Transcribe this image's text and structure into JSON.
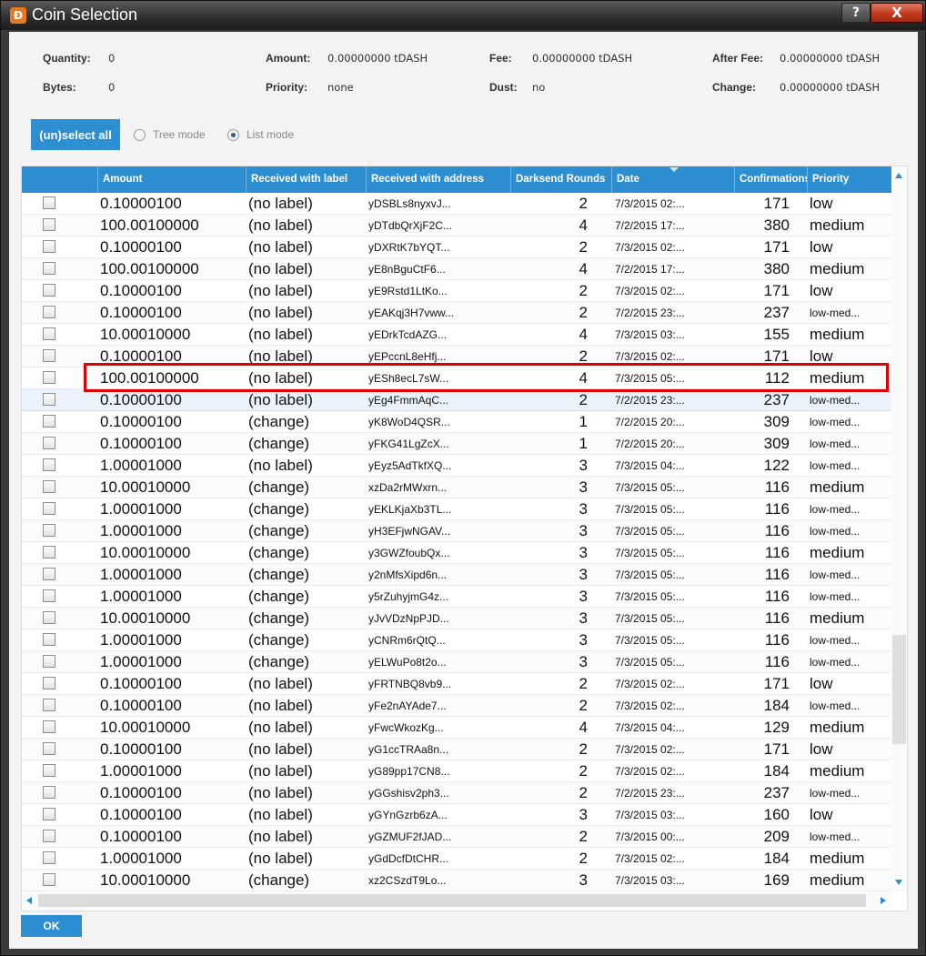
{
  "window": {
    "title": "Coin Selection",
    "help_label": "?",
    "close_label": "X"
  },
  "summary": {
    "quantity_label": "Quantity:",
    "quantity": "0",
    "bytes_label": "Bytes:",
    "bytes": "0",
    "amount_label": "Amount:",
    "amount": "0.00000000 tDASH",
    "priority_label": "Priority:",
    "priority": "none",
    "fee_label": "Fee:",
    "fee": "0.00000000 tDASH",
    "dust_label": "Dust:",
    "dust": "no",
    "after_fee_label": "After Fee:",
    "after_fee": "0.00000000 tDASH",
    "change_label": "Change:",
    "change": "0.00000000 tDASH"
  },
  "controls": {
    "select_all_label": "(un)select all",
    "tree_mode_label": "Tree mode",
    "list_mode_label": "List mode",
    "selected_mode": "list"
  },
  "table": {
    "columns": [
      "",
      "Amount",
      "Received with label",
      "Received with address",
      "Darksend Rounds",
      "Date",
      "Confirmations",
      "Priority"
    ],
    "rows": [
      {
        "amount": "0.10000100",
        "label": "(no label)",
        "address": "yDSBLs8nyxvJ...",
        "rounds": "2",
        "date": "7/3/2015 02:...",
        "conf": "171",
        "priority": "low"
      },
      {
        "amount": "100.00100000",
        "label": "(no label)",
        "address": "yDTdbQrXjF2C...",
        "rounds": "4",
        "date": "7/2/2015 17:...",
        "conf": "380",
        "priority": "medium"
      },
      {
        "amount": "0.10000100",
        "label": "(no label)",
        "address": "yDXRtK7bYQT...",
        "rounds": "2",
        "date": "7/3/2015 02:...",
        "conf": "171",
        "priority": "low"
      },
      {
        "amount": "100.00100000",
        "label": "(no label)",
        "address": "yE8nBguCtF6...",
        "rounds": "4",
        "date": "7/2/2015 17:...",
        "conf": "380",
        "priority": "medium"
      },
      {
        "amount": "0.10000100",
        "label": "(no label)",
        "address": "yE9Rstd1LtKo...",
        "rounds": "2",
        "date": "7/3/2015 02:...",
        "conf": "171",
        "priority": "low"
      },
      {
        "amount": "0.10000100",
        "label": "(no label)",
        "address": "yEAKqj3H7vww...",
        "rounds": "2",
        "date": "7/2/2015 23:...",
        "conf": "237",
        "priority": "low-med..."
      },
      {
        "amount": "10.00010000",
        "label": "(no label)",
        "address": "yEDrkTcdAZG...",
        "rounds": "4",
        "date": "7/3/2015 03:...",
        "conf": "155",
        "priority": "medium"
      },
      {
        "amount": "0.10000100",
        "label": "(no label)",
        "address": "yEPccnL8eHfj...",
        "rounds": "2",
        "date": "7/3/2015 02:...",
        "conf": "171",
        "priority": "low"
      },
      {
        "amount": "100.00100000",
        "label": "(no label)",
        "address": "yESh8ecL7sW...",
        "rounds": "4",
        "date": "7/3/2015 05:...",
        "conf": "112",
        "priority": "medium"
      },
      {
        "amount": "0.10000100",
        "label": "(no label)",
        "address": "yEg4FmmAqC...",
        "rounds": "2",
        "date": "7/2/2015 23:...",
        "conf": "237",
        "priority": "low-med..."
      },
      {
        "amount": "0.10000100",
        "label": "(change)",
        "address": "yK8WoD4QSR...",
        "rounds": "1",
        "date": "7/2/2015 20:...",
        "conf": "309",
        "priority": "low-med..."
      },
      {
        "amount": "0.10000100",
        "label": "(change)",
        "address": "yFKG41LgZcX...",
        "rounds": "1",
        "date": "7/2/2015 20:...",
        "conf": "309",
        "priority": "low-med..."
      },
      {
        "amount": "1.00001000",
        "label": "(no label)",
        "address": "yEyz5AdTkfXQ...",
        "rounds": "3",
        "date": "7/3/2015 04:...",
        "conf": "122",
        "priority": "low-med..."
      },
      {
        "amount": "10.00010000",
        "label": "(change)",
        "address": "xzDa2rMWxrn...",
        "rounds": "3",
        "date": "7/3/2015 05:...",
        "conf": "116",
        "priority": "medium"
      },
      {
        "amount": "1.00001000",
        "label": "(change)",
        "address": "yEKLKjaXb3TL...",
        "rounds": "3",
        "date": "7/3/2015 05:...",
        "conf": "116",
        "priority": "low-med..."
      },
      {
        "amount": "1.00001000",
        "label": "(change)",
        "address": "yH3EFjwNGAV...",
        "rounds": "3",
        "date": "7/3/2015 05:...",
        "conf": "116",
        "priority": "low-med..."
      },
      {
        "amount": "10.00010000",
        "label": "(change)",
        "address": "y3GWZfoubQx...",
        "rounds": "3",
        "date": "7/3/2015 05:...",
        "conf": "116",
        "priority": "medium"
      },
      {
        "amount": "1.00001000",
        "label": "(change)",
        "address": "y2nMfsXipd6n...",
        "rounds": "3",
        "date": "7/3/2015 05:...",
        "conf": "116",
        "priority": "low-med..."
      },
      {
        "amount": "1.00001000",
        "label": "(change)",
        "address": "y5rZuhyjmG4z...",
        "rounds": "3",
        "date": "7/3/2015 05:...",
        "conf": "116",
        "priority": "low-med..."
      },
      {
        "amount": "10.00010000",
        "label": "(change)",
        "address": "yJvVDzNpPJD...",
        "rounds": "3",
        "date": "7/3/2015 05:...",
        "conf": "116",
        "priority": "medium"
      },
      {
        "amount": "1.00001000",
        "label": "(change)",
        "address": "yCNRm6rQtQ...",
        "rounds": "3",
        "date": "7/3/2015 05:...",
        "conf": "116",
        "priority": "low-med..."
      },
      {
        "amount": "1.00001000",
        "label": "(change)",
        "address": "yELWuPo8t2o...",
        "rounds": "3",
        "date": "7/3/2015 05:...",
        "conf": "116",
        "priority": "low-med..."
      },
      {
        "amount": "0.10000100",
        "label": "(no label)",
        "address": "yFRTNBQ8vb9...",
        "rounds": "2",
        "date": "7/3/2015 02:...",
        "conf": "171",
        "priority": "low"
      },
      {
        "amount": "0.10000100",
        "label": "(no label)",
        "address": "yFe2nAYAde7...",
        "rounds": "2",
        "date": "7/3/2015 02:...",
        "conf": "184",
        "priority": "low-med..."
      },
      {
        "amount": "10.00010000",
        "label": "(no label)",
        "address": "yFwcWkozKg...",
        "rounds": "4",
        "date": "7/3/2015 04:...",
        "conf": "129",
        "priority": "medium"
      },
      {
        "amount": "0.10000100",
        "label": "(no label)",
        "address": "yG1ccTRAa8n...",
        "rounds": "2",
        "date": "7/3/2015 02:...",
        "conf": "171",
        "priority": "low"
      },
      {
        "amount": "1.00001000",
        "label": "(no label)",
        "address": "yG89pp17CN8...",
        "rounds": "2",
        "date": "7/3/2015 02:...",
        "conf": "184",
        "priority": "medium"
      },
      {
        "amount": "0.10000100",
        "label": "(no label)",
        "address": "yGGshisv2ph3...",
        "rounds": "2",
        "date": "7/2/2015 23:...",
        "conf": "237",
        "priority": "low-med..."
      },
      {
        "amount": "0.10000100",
        "label": "(no label)",
        "address": "yGYnGzrb6zA...",
        "rounds": "3",
        "date": "7/3/2015 03:...",
        "conf": "160",
        "priority": "low"
      },
      {
        "amount": "0.10000100",
        "label": "(no label)",
        "address": "yGZMUF2fJAD...",
        "rounds": "2",
        "date": "7/3/2015 00:...",
        "conf": "209",
        "priority": "low-med..."
      },
      {
        "amount": "1.00001000",
        "label": "(no label)",
        "address": "yGdDcfDtCHR...",
        "rounds": "2",
        "date": "7/3/2015 02:...",
        "conf": "184",
        "priority": "medium"
      },
      {
        "amount": "10.00010000",
        "label": "(change)",
        "address": "xz2CSzdT9Lo...",
        "rounds": "3",
        "date": "7/3/2015 03:...",
        "conf": "169",
        "priority": "medium"
      }
    ]
  },
  "footer": {
    "ok_label": "OK"
  },
  "colors": {
    "accent": "#2d8fd1",
    "highlight": "#e00000",
    "close": "#c23a1e"
  }
}
